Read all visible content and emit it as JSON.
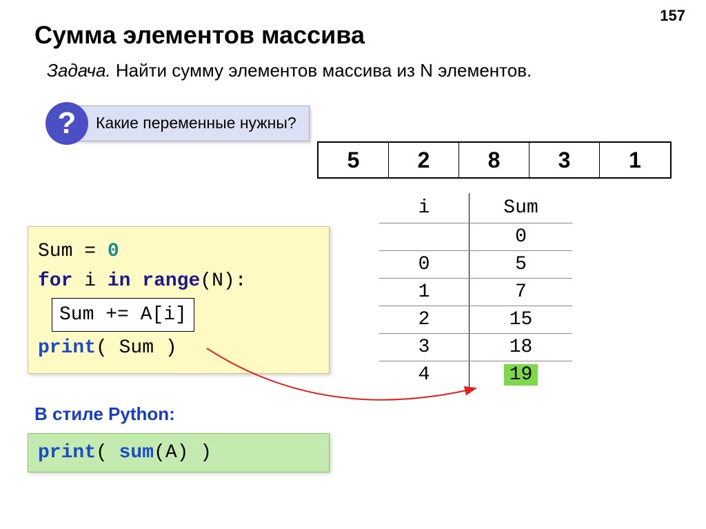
{
  "pageNumber": "157",
  "title": "Сумма элементов массива",
  "taskLabel": "Задача.",
  "taskText": " Найти сумму элементов массива из N элементов.",
  "question": {
    "mark": "?",
    "text": "Какие переменные нужны?"
  },
  "array": [
    "5",
    "2",
    "8",
    "3",
    "1"
  ],
  "trace": {
    "headers": [
      "i",
      "Sum"
    ],
    "rows": [
      {
        "i": "",
        "sum": "0"
      },
      {
        "i": "0",
        "sum": "5"
      },
      {
        "i": "1",
        "sum": "7"
      },
      {
        "i": "2",
        "sum": "15"
      },
      {
        "i": "3",
        "sum": "18"
      },
      {
        "i": "4",
        "sum": "19",
        "highlight": true
      }
    ]
  },
  "code": {
    "line1_a": "Sum = ",
    "line1_b": "0",
    "line2_a": "for",
    "line2_b": " i ",
    "line2_c": "in",
    "line2_d": " ",
    "line2_e": "range",
    "line2_f": "(N):",
    "line3": "Sum += A[i]",
    "line4_a": "print",
    "line4_b": "( Sum )"
  },
  "pythonLabel": "В стиле Python:",
  "pythonCode_a": "print",
  "pythonCode_b": "( ",
  "pythonCode_c": "sum",
  "pythonCode_d": "(A) )"
}
